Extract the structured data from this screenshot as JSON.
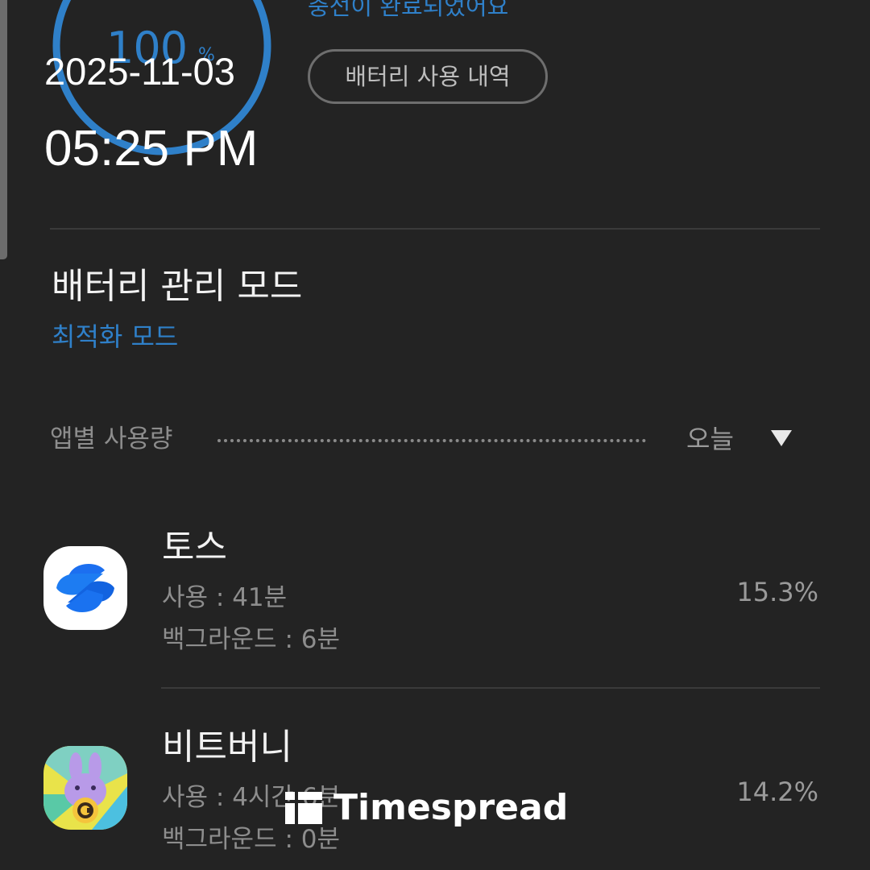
{
  "battery": {
    "percent": "100",
    "percent_unit": "%",
    "charge_status": "충전이 완료되었어요",
    "usage_history_button": "배터리 사용 내역",
    "ring_color": "#2f80c9"
  },
  "overlay": {
    "date": "2025-11-03",
    "time": "05:25 PM"
  },
  "battery_mode": {
    "title": "배터리 관리 모드",
    "value": "최적화 모드"
  },
  "app_usage": {
    "header": "앱별 사용량",
    "period": "오늘",
    "apps": [
      {
        "name": "토스",
        "usage": "사용 : 41분",
        "background": "백그라운드 : 6분",
        "percent": "15.3%",
        "icon": "toss-icon"
      },
      {
        "name": "비트버니",
        "usage": "사용 : 4시간 6분",
        "background": "백그라운드 : 0분",
        "percent": "14.2%",
        "icon": "bitbunny-icon"
      }
    ]
  },
  "watermark": {
    "text": "Timespread"
  },
  "colors": {
    "background": "#232323",
    "accent": "#2f80c9",
    "primary_text": "#f2f2f2",
    "secondary_text": "#8d8d8d"
  }
}
